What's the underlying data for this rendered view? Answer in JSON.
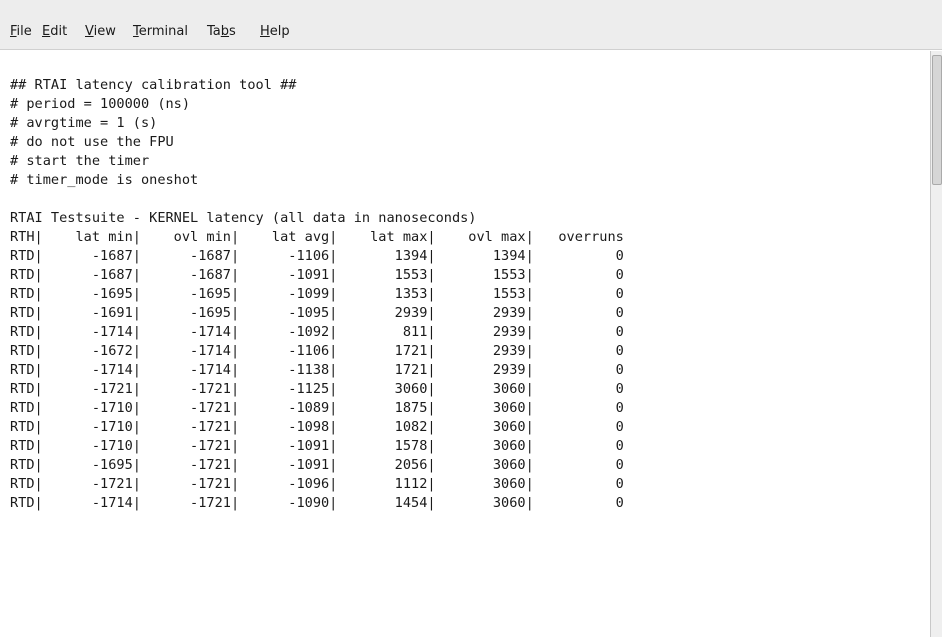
{
  "menubar": {
    "items": [
      {
        "pre": "",
        "mnemonic": "F",
        "post": "ile"
      },
      {
        "pre": "",
        "mnemonic": "E",
        "post": "dit"
      },
      {
        "pre": "",
        "mnemonic": "V",
        "post": "iew"
      },
      {
        "pre": "",
        "mnemonic": "T",
        "post": "erminal"
      },
      {
        "pre": "Ta",
        "mnemonic": "b",
        "post": "s"
      },
      {
        "pre": "",
        "mnemonic": "H",
        "post": "elp"
      }
    ]
  },
  "terminal": {
    "lines": [
      "## RTAI latency calibration tool ##",
      "# period = 100000 (ns)",
      "# avrgtime = 1 (s)",
      "# do not use the FPU",
      "# start the timer",
      "# timer_mode is oneshot",
      "",
      "RTAI Testsuite - KERNEL latency (all data in nanoseconds)",
      "RTH|    lat min|    ovl min|    lat avg|    lat max|    ovl max|   overruns",
      "RTD|      -1687|      -1687|      -1106|       1394|       1394|          0",
      "RTD|      -1687|      -1687|      -1091|       1553|       1553|          0",
      "RTD|      -1695|      -1695|      -1099|       1353|       1553|          0",
      "RTD|      -1691|      -1695|      -1095|       2939|       2939|          0",
      "RTD|      -1714|      -1714|      -1092|        811|       2939|          0",
      "RTD|      -1672|      -1714|      -1106|       1721|       2939|          0",
      "RTD|      -1714|      -1714|      -1138|       1721|       2939|          0",
      "RTD|      -1721|      -1721|      -1125|       3060|       3060|          0",
      "RTD|      -1710|      -1721|      -1089|       1875|       3060|          0",
      "RTD|      -1710|      -1721|      -1098|       1082|       3060|          0",
      "RTD|      -1710|      -1721|      -1091|       1578|       3060|          0",
      "RTD|      -1695|      -1721|      -1091|       2056|       3060|          0",
      "RTD|      -1721|      -1721|      -1096|       1112|       3060|          0",
      "RTD|      -1714|      -1721|      -1090|       1454|       3060|          0"
    ]
  }
}
